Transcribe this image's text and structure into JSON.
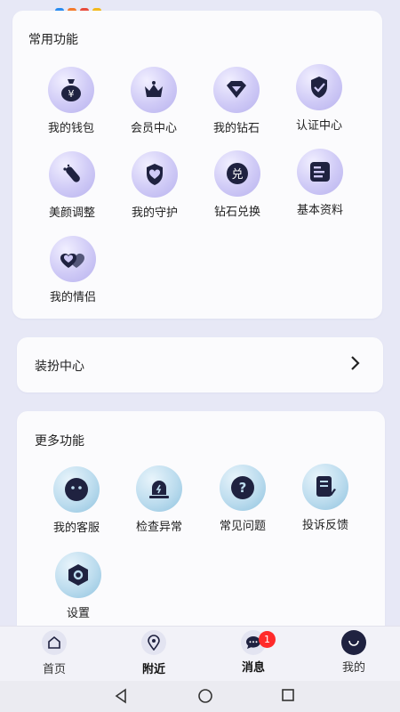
{
  "common": {
    "title": "常用功能",
    "items": [
      {
        "label": "我的钱包",
        "icon": "money-bag-icon"
      },
      {
        "label": "会员中心",
        "icon": "crown-icon"
      },
      {
        "label": "我的钻石",
        "icon": "diamond-icon"
      },
      {
        "label": "认证中心",
        "icon": "shield-check-icon"
      },
      {
        "label": "美颜调整",
        "icon": "magic-pen-icon"
      },
      {
        "label": "我的守护",
        "icon": "shield-heart-icon"
      },
      {
        "label": "钻石兑换",
        "icon": "exchange-icon"
      },
      {
        "label": "基本资料",
        "icon": "profile-doc-icon"
      },
      {
        "label": "我的情侣",
        "icon": "hearts-icon"
      }
    ]
  },
  "dress": {
    "label": "装扮中心"
  },
  "more": {
    "title": "更多功能",
    "items": [
      {
        "label": "我的客服",
        "icon": "chat-bot-icon"
      },
      {
        "label": "检查异常",
        "icon": "alarm-icon"
      },
      {
        "label": "常见问题",
        "icon": "question-icon"
      },
      {
        "label": "投诉反馈",
        "icon": "feedback-edit-icon"
      },
      {
        "label": "设置",
        "icon": "settings-hex-icon"
      }
    ]
  },
  "tabs": [
    {
      "label": "首页"
    },
    {
      "label": "附近"
    },
    {
      "label": "消息",
      "badge": "1"
    },
    {
      "label": "我的"
    }
  ],
  "colors": {
    "accent": "#1f2240",
    "badge": "#ff2a2a",
    "page_bg": "#e7e8f6"
  }
}
